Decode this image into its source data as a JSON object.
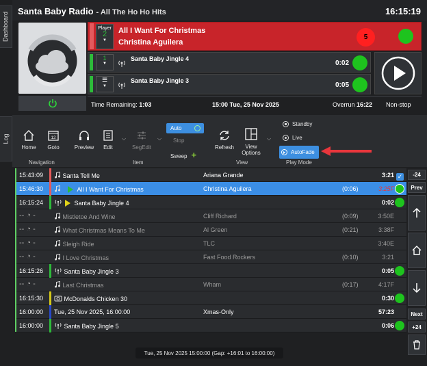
{
  "app": {
    "title": "Santa Baby Radio",
    "subtitle": "- All The Ho Ho Hits",
    "clock": "16:15:19"
  },
  "tabs": {
    "dashboard": "Dashboard",
    "log": "Log"
  },
  "player_on_air": {
    "player_label": "Player",
    "player_number": "2",
    "song": "All I Want For Christmas",
    "artist": "Christina Aguilera",
    "badge": "5",
    "color": "#c8242a"
  },
  "player2": {
    "number": "1",
    "title": "Santa Baby Jingle 4",
    "time": "0:02"
  },
  "player3": {
    "title": "Santa Baby Jingle 3",
    "time": "0:05"
  },
  "status": {
    "time_remaining_label": "Time Remaining:",
    "time_remaining": "1:03",
    "datetime": "15:00 Tue, 25 Nov 2025",
    "overrun_label": "Overrun",
    "overrun": "16:22",
    "mode": "Non-stop"
  },
  "ribbon": {
    "home": "Home",
    "goto": "Goto",
    "goto_num": "12",
    "preview": "Preview",
    "edit": "Edit",
    "segedit": "SegEdit",
    "auto": "Auto",
    "stop": "Stop",
    "sweep": "Sweep",
    "refresh": "Refresh",
    "view_options_1": "View",
    "view_options_2": "Options",
    "standby": "Standby",
    "live": "Live",
    "autofade": "AutoFade",
    "group_navigation": "Navigation",
    "group_item": "Item",
    "group_view": "View",
    "group_playmode": "Play Mode"
  },
  "log_rows": [
    {
      "time": "15:43:09",
      "icon": "music-note",
      "title": "Santa Tell Me",
      "artist": "Ariana Grande",
      "dur": "",
      "len": "3:21",
      "stripe": "#e55a5a",
      "state": "played"
    },
    {
      "time": "15:46:30",
      "icon": "play-music",
      "title": "All I Want For Christmas",
      "artist": "Christina Aguilera",
      "dur": "(0:06)",
      "len": "3:25F",
      "stripe": "#e55a5a",
      "state": "selected"
    },
    {
      "time": "16:15:24",
      "icon": "jingle-play",
      "title": "Santa Baby Jingle 4",
      "artist": "",
      "dur": "",
      "len": "0:02",
      "stripe": "#2dbb3a",
      "state": "next"
    },
    {
      "time": "",
      "icon": "music-note",
      "title": "Mistletoe And Wine",
      "artist": "Cliff Richard",
      "dur": "(0:09)",
      "len": "3:50E",
      "stripe": "",
      "state": "dim"
    },
    {
      "time": "",
      "icon": "music-note",
      "title": "What Christmas Means To Me",
      "artist": "Al Green",
      "dur": "(0:21)",
      "len": "3:38F",
      "stripe": "",
      "state": "dim"
    },
    {
      "time": "",
      "icon": "music-note",
      "title": "Sleigh Ride",
      "artist": "TLC",
      "dur": "",
      "len": "3:40E",
      "stripe": "",
      "state": "dim"
    },
    {
      "time": "",
      "icon": "music-note",
      "title": "I Love Christmas",
      "artist": "Fast Food Rockers",
      "dur": "(0:10)",
      "len": "3:21",
      "stripe": "",
      "state": "dim"
    },
    {
      "time": "16:15:26",
      "icon": "jingle",
      "title": "Santa Baby Jingle 3",
      "artist": "",
      "dur": "",
      "len": "0:05",
      "stripe": "#2dbb3a",
      "state": "next"
    },
    {
      "time": "",
      "icon": "music-note",
      "title": "Last Christmas",
      "artist": "Wham",
      "dur": "(0:17)",
      "len": "4:17F",
      "stripe": "",
      "state": "dim"
    },
    {
      "time": "16:15:30",
      "icon": "ad",
      "title": "McDonalds Chicken 30",
      "artist": "",
      "dur": "",
      "len": "0:30",
      "stripe": "#d4c81a",
      "state": "next"
    },
    {
      "time": "16:00:00",
      "icon": "",
      "title": "Tue, 25 Nov 2025, 16:00:00",
      "artist": "Xmas-Only",
      "dur": "",
      "len": "57:23",
      "stripe": "#2848c8",
      "state": "marker"
    },
    {
      "time": "16:00:00",
      "icon": "jingle",
      "title": "Santa Baby Jingle 5",
      "artist": "",
      "dur": "",
      "len": "0:06",
      "stripe": "#2dbb3a",
      "state": "next"
    }
  ],
  "sidebar": {
    "minus24": "-24",
    "prev": "Prev",
    "next": "Next",
    "plus24": "+24"
  },
  "footer": "Tue, 25 Nov 2025 15:00:00 (Gap: +16:01 to 16:00:00)"
}
